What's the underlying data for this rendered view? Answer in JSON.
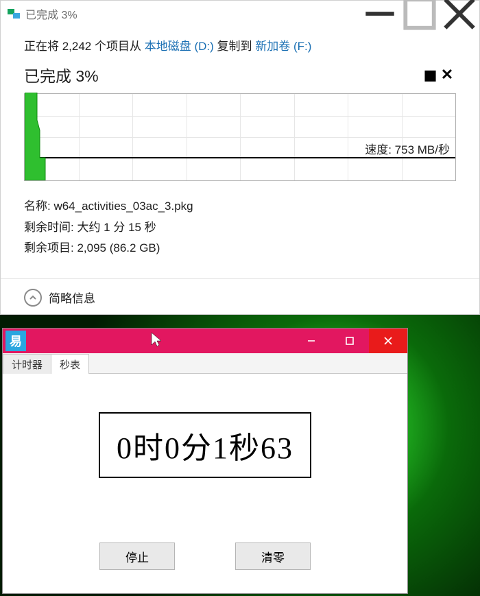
{
  "copy_window": {
    "title": "已完成 3%",
    "summary_prefix": "正在将 2,242 个项目从 ",
    "source_link": "本地磁盘 (D:)",
    "summary_mid": " 复制到 ",
    "dest_link": "新加卷 (F:)",
    "percent_line": "已完成 3%",
    "speed_label": "速度: 753 MB/秒",
    "meta_name_label": "名称: ",
    "meta_name_value": "w64_activities_03ac_3.pkg",
    "meta_time_label": "剩余时间: ",
    "meta_time_value": "大约 1 分 15 秒",
    "meta_items_label": "剩余项目: ",
    "meta_items_value": "2,095 (86.2 GB)",
    "footer_toggle": "简略信息"
  },
  "stopwatch_window": {
    "icon_glyph": "易",
    "tab_timer": "计时器",
    "tab_stopwatch": "秒表",
    "display": "0时0分1秒63",
    "btn_stop": "停止",
    "btn_clear": "清零"
  }
}
